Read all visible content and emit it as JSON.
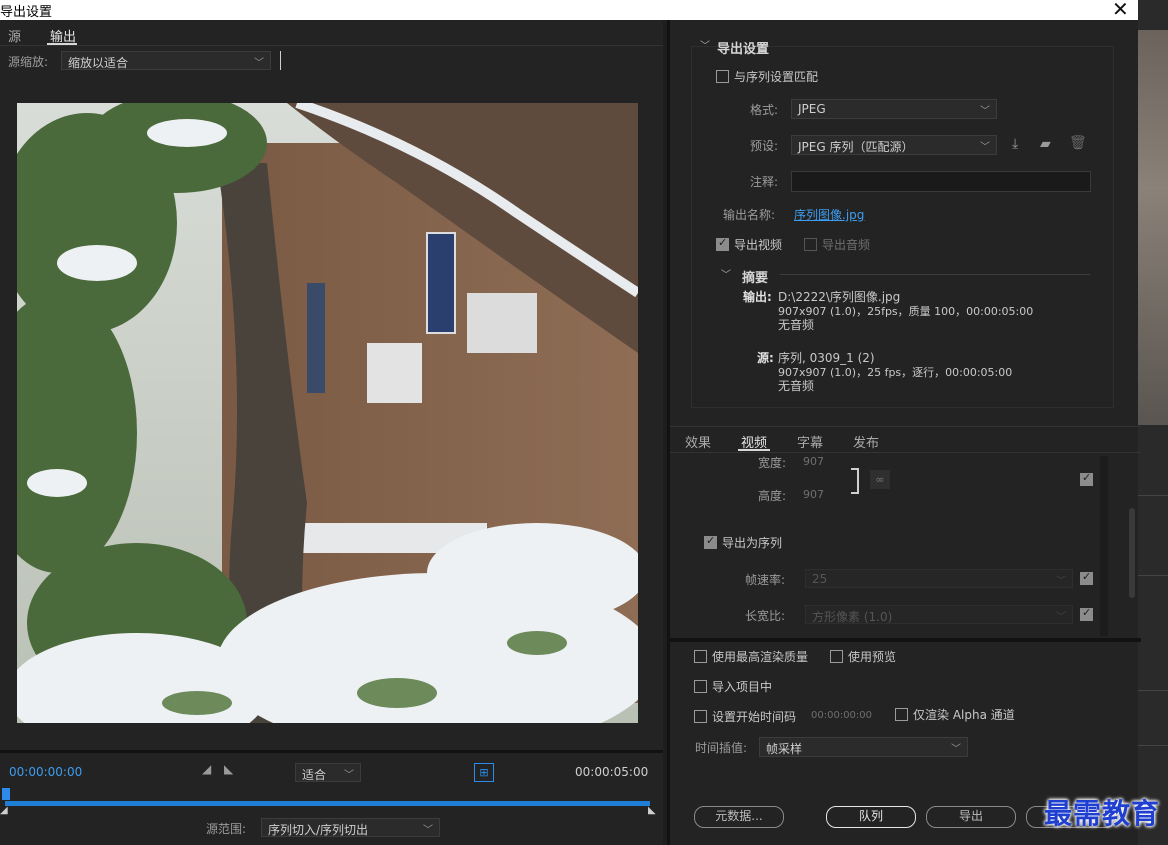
{
  "window": {
    "title": "导出设置",
    "close_glyph": "✕"
  },
  "left": {
    "tabs": [
      "源",
      "输出"
    ],
    "source_zoom": {
      "label": "源缩放:",
      "value": "缩放以适合"
    },
    "timeline": {
      "timecode_start": "00:00:00:00",
      "timecode_end": "00:00:05:00",
      "fit_value": "适合",
      "range_label": "源范围:",
      "range_value": "序列切入/序列切出"
    }
  },
  "export_settings": {
    "section_title": "导出设置",
    "match_sequence": "与序列设置匹配",
    "format_label": "格式:",
    "format_value": "JPEG",
    "preset_label": "预设:",
    "preset_value": "JPEG 序列（匹配源）",
    "comment_label": "注释:",
    "output_name_label": "输出名称:",
    "output_name_value": "序列图像.jpg",
    "export_video": "导出视频",
    "export_audio": "导出音频",
    "summary": {
      "title": "摘要",
      "output_label": "输出:",
      "output_line1": "D:\\2222\\序列图像.jpg",
      "output_line2": "907x907 (1.0)，25fps，质量 100，00:00:05:00",
      "output_line3": "无音频",
      "source_label": "源:",
      "source_line1": "序列, 0309_1 (2)",
      "source_line2": "907x907 (1.0)，25 fps，逐行，00:00:05:00",
      "source_line3": "无音频"
    }
  },
  "video_tabs": [
    "效果",
    "视频",
    "字幕",
    "发布"
  ],
  "video_settings": {
    "width_label": "宽度:",
    "width_value": "907",
    "height_label": "高度:",
    "height_value": "907",
    "export_as_sequence": "导出为序列",
    "framerate_label": "帧速率:",
    "framerate_value": "25",
    "aspect_label": "长宽比:",
    "aspect_value": "方形像素 (1.0)"
  },
  "bottom": {
    "max_render_quality": "使用最高渲染质量",
    "use_previews": "使用预览",
    "import_into_project": "导入项目中",
    "set_start_timecode": "设置开始时间码",
    "start_timecode_value": "00:00:00:00",
    "render_alpha_only": "仅渲染 Alpha 通道",
    "time_interp_label": "时间插值:",
    "time_interp_value": "帧采样",
    "metadata_button": "元数据...",
    "queue_button": "队列",
    "export_button": "导出"
  },
  "watermark": "最需教育",
  "colors": {
    "accent": "#2d8ceb",
    "timecode": "#3d9df0"
  }
}
